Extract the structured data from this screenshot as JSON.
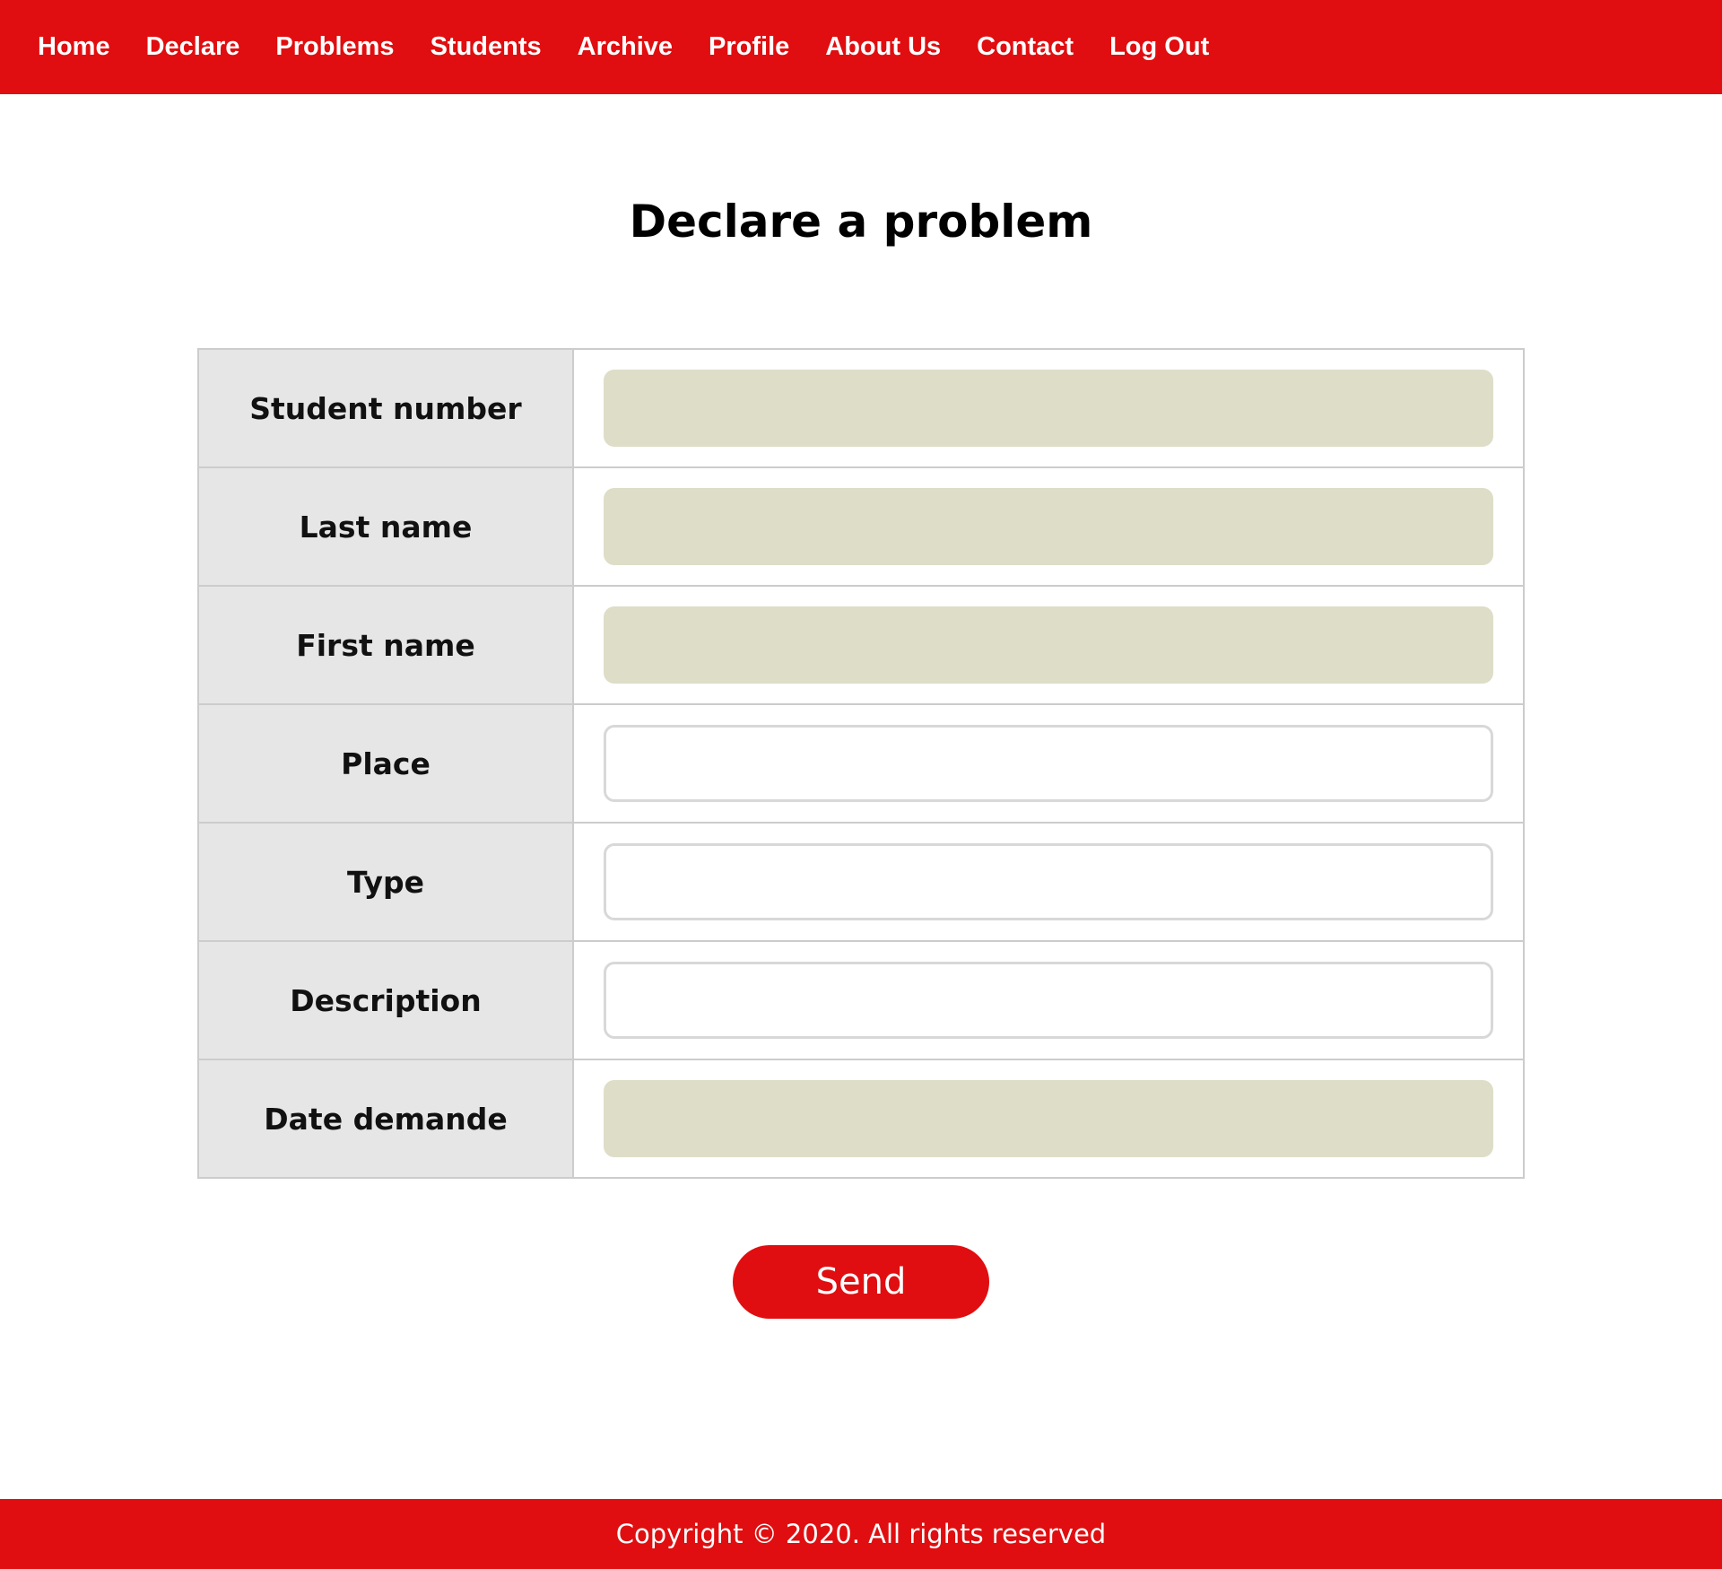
{
  "nav": {
    "items": [
      {
        "label": "Home"
      },
      {
        "label": "Declare"
      },
      {
        "label": "Problems"
      },
      {
        "label": "Students"
      },
      {
        "label": "Archive"
      },
      {
        "label": "Profile"
      },
      {
        "label": "About Us"
      },
      {
        "label": "Contact"
      },
      {
        "label": "Log Out"
      }
    ]
  },
  "main": {
    "title": "Declare a problem",
    "form": {
      "rows": [
        {
          "label": "Student number",
          "value": "",
          "readonly": true
        },
        {
          "label": "Last name",
          "value": "",
          "readonly": true
        },
        {
          "label": "First name",
          "value": "",
          "readonly": true
        },
        {
          "label": "Place",
          "value": "",
          "readonly": false
        },
        {
          "label": "Type",
          "value": "",
          "readonly": false
        },
        {
          "label": "Description",
          "value": "",
          "readonly": false
        },
        {
          "label": "Date demande",
          "value": "",
          "readonly": true
        }
      ]
    },
    "send_label": "Send"
  },
  "footer": {
    "text": "Copyright © 2020. All rights reserved"
  },
  "colors": {
    "brand_red": "#e00e10",
    "readonly_field": "#deddc8",
    "label_bg": "#e6e6e6",
    "border": "#cccccc"
  }
}
